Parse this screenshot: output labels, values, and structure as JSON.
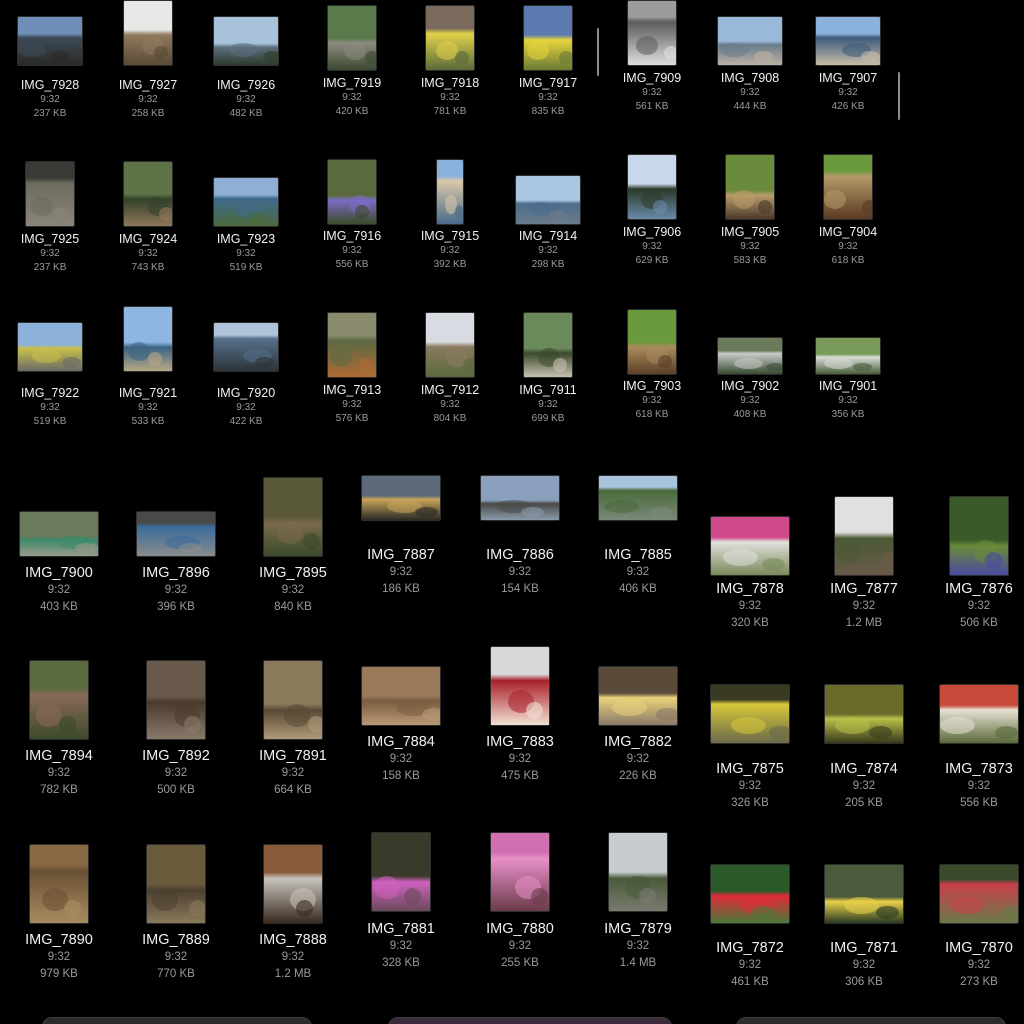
{
  "panes": [
    {
      "id": "pane-a",
      "columns": [
        "IMG_7928|237 KB",
        "IMG_7927|258 KB",
        "IMG_7926|482 KB"
      ],
      "rows": [
        [
          {
            "name": "IMG_7928",
            "time": "9:32",
            "size": "237 KB",
            "palette": [
              "#6f8fb8",
              "#3c4a58",
              "#2a2a26"
            ]
          },
          {
            "name": "IMG_7927",
            "time": "9:32",
            "size": "258 KB",
            "palette": [
              "#e8e8e6",
              "#8f7a5e",
              "#5a4a36"
            ]
          },
          {
            "name": "IMG_7926",
            "time": "9:32",
            "size": "482 KB",
            "palette": [
              "#a9c2dc",
              "#5b6f7d",
              "#2e3a2c"
            ]
          }
        ],
        [
          {
            "name": "IMG_7925",
            "time": "9:32",
            "size": "237 KB",
            "palette": [
              "#3a3a36",
              "#6d6a5f",
              "#8a8578"
            ]
          },
          {
            "name": "IMG_7924",
            "time": "9:32",
            "size": "743 KB",
            "palette": [
              "#5e7448",
              "#33422a",
              "#8f7658"
            ]
          },
          {
            "name": "IMG_7923",
            "time": "9:32",
            "size": "519 KB",
            "palette": [
              "#8fb0d4",
              "#3f6a8c",
              "#4c6a3c"
            ]
          }
        ],
        [
          {
            "name": "IMG_7922",
            "time": "9:32",
            "size": "519 KB",
            "palette": [
              "#8cb2dc",
              "#c8c04a",
              "#6a6a66"
            ]
          },
          {
            "name": "IMG_7921",
            "time": "9:32",
            "size": "533 KB",
            "palette": [
              "#8fb6e0",
              "#3c6484",
              "#b8a884"
            ]
          },
          {
            "name": "IMG_7920",
            "time": "9:32",
            "size": "422 KB",
            "palette": [
              "#aec4da",
              "#55708a",
              "#2e3438"
            ]
          }
        ]
      ]
    },
    {
      "id": "pane-b",
      "rows": [
        [
          {
            "name": "IMG_7919",
            "time": "9:32",
            "size": "420 KB",
            "palette": [
              "#5a7a4c",
              "#8a8a7c",
              "#3c4a32"
            ]
          },
          {
            "name": "IMG_7918",
            "time": "9:32",
            "size": "781 KB",
            "palette": [
              "#7a6a5c",
              "#e0d24a",
              "#5a6a3a"
            ]
          },
          {
            "name": "IMG_7917",
            "time": "9:32",
            "size": "835 KB",
            "palette": [
              "#5a7ab0",
              "#e6d43c",
              "#6a7a34"
            ]
          }
        ],
        [
          {
            "name": "IMG_7916",
            "time": "9:32",
            "size": "556 KB",
            "palette": [
              "#5a6a3c",
              "#7a6cc4",
              "#3c4a2a"
            ]
          },
          {
            "name": "IMG_7915",
            "time": "9:32",
            "size": "392 KB",
            "palette": [
              "#8ab0dc",
              "#d8c8a8",
              "#4a6a8a"
            ]
          },
          {
            "name": "IMG_7914",
            "time": "9:32",
            "size": "298 KB",
            "palette": [
              "#aac6e2",
              "#4c6c8c",
              "#6c7c8c"
            ]
          }
        ],
        [
          {
            "name": "IMG_7913",
            "time": "9:32",
            "size": "576 KB",
            "palette": [
              "#8a8a6c",
              "#5c6a44",
              "#b06a34"
            ]
          },
          {
            "name": "IMG_7912",
            "time": "9:32",
            "size": "804 KB",
            "palette": [
              "#d8dce2",
              "#8a7a60",
              "#5a6a3c"
            ]
          },
          {
            "name": "IMG_7911",
            "time": "9:32",
            "size": "699 KB",
            "palette": [
              "#6a8a5c",
              "#3a4a2c",
              "#c8c0b0"
            ]
          }
        ]
      ]
    },
    {
      "id": "pane-c",
      "rows": [
        [
          {
            "name": "IMG_7909",
            "time": "9:32",
            "size": "561 KB",
            "palette": [
              "#9a9c9e",
              "#5a5c5a",
              "#dedfe0"
            ]
          },
          {
            "name": "IMG_7908",
            "time": "9:32",
            "size": "444 KB",
            "palette": [
              "#9ab8da",
              "#6a7c8a",
              "#bcb0a4"
            ]
          },
          {
            "name": "IMG_7907",
            "time": "9:32",
            "size": "426 KB",
            "palette": [
              "#8ab0dc",
              "#3c5a7a",
              "#c8bca8"
            ]
          }
        ],
        [
          {
            "name": "IMG_7906",
            "time": "9:32",
            "size": "629 KB",
            "palette": [
              "#c8d8ea",
              "#2c3a2a",
              "#6a8aa8"
            ]
          },
          {
            "name": "IMG_7905",
            "time": "9:32",
            "size": "583 KB",
            "palette": [
              "#6a8a3c",
              "#b89c6a",
              "#4a3a2a"
            ]
          },
          {
            "name": "IMG_7904",
            "time": "9:32",
            "size": "618 KB",
            "palette": [
              "#6a9a3c",
              "#b49a6a",
              "#5a3a22"
            ]
          }
        ],
        [
          {
            "name": "IMG_7903",
            "time": "9:32",
            "size": "618 KB",
            "palette": [
              "#6a9a3c",
              "#a88a5c",
              "#5c4028"
            ]
          },
          {
            "name": "IMG_7902",
            "time": "9:32",
            "size": "408 KB",
            "palette": [
              "#6a7a5a",
              "#c8ccc8",
              "#3a4a32"
            ]
          },
          {
            "name": "IMG_7901",
            "time": "9:32",
            "size": "356 KB",
            "palette": [
              "#7a9a5a",
              "#d8dcd8",
              "#4a5c3a"
            ]
          }
        ]
      ]
    },
    {
      "id": "pane-d",
      "rows": [
        [
          {
            "name": "IMG_7900",
            "time": "9:32",
            "size": "403 KB",
            "palette": [
              "#6a7a5a",
              "#3c8a6a",
              "#9a9a8a"
            ]
          },
          {
            "name": "IMG_7896",
            "time": "9:32",
            "size": "396 KB",
            "palette": [
              "#4a4a48",
              "#3a6a9a",
              "#8a8c8c"
            ]
          },
          {
            "name": "IMG_7895",
            "time": "9:32",
            "size": "840 KB",
            "palette": [
              "#5a5a3a",
              "#7a6a4c",
              "#3a4a2a"
            ]
          }
        ],
        [
          {
            "name": "IMG_7894",
            "time": "9:32",
            "size": "782 KB",
            "palette": [
              "#5a6a3c",
              "#8a6a5a",
              "#3c4a2a"
            ]
          },
          {
            "name": "IMG_7892",
            "time": "9:32",
            "size": "500 KB",
            "palette": [
              "#6a5a4c",
              "#4a3a2c",
              "#8a7a6a"
            ]
          },
          {
            "name": "IMG_7891",
            "time": "9:32",
            "size": "664 KB",
            "palette": [
              "#8a7a5c",
              "#5a4a34",
              "#b09a7a"
            ]
          }
        ],
        [
          {
            "name": "IMG_7890",
            "time": "9:32",
            "size": "979 KB",
            "palette": [
              "#8a6a44",
              "#6a5034",
              "#a88c60"
            ]
          },
          {
            "name": "IMG_7889",
            "time": "9:32",
            "size": "770 KB",
            "palette": [
              "#6a5a3c",
              "#4c4030",
              "#8a7a5a"
            ]
          },
          {
            "name": "IMG_7888",
            "time": "9:32",
            "size": "1.2 MB",
            "palette": [
              "#8a5a3c",
              "#c8c4bc",
              "#3a2a20"
            ]
          }
        ]
      ]
    },
    {
      "id": "pane-e",
      "rows": [
        [
          {
            "name": "IMG_7887",
            "time": "9:32",
            "size": "186 KB",
            "palette": [
              "#5c6a7a",
              "#c8a45a",
              "#2a2a26"
            ]
          },
          {
            "name": "IMG_7886",
            "time": "9:32",
            "size": "154 KB",
            "palette": [
              "#8aa0bc",
              "#4a4a48",
              "#8a9aaa"
            ]
          },
          {
            "name": "IMG_7885",
            "time": "9:32",
            "size": "406 KB",
            "palette": [
              "#a8c4dc",
              "#4a6a3a",
              "#7a8a7a"
            ]
          }
        ],
        [
          {
            "name": "IMG_7884",
            "time": "9:32",
            "size": "158 KB",
            "palette": [
              "#9a7a5a",
              "#7a5c40",
              "#b89a76"
            ]
          },
          {
            "name": "IMG_7883",
            "time": "9:32",
            "size": "475 KB",
            "palette": [
              "#d8d8d8",
              "#a8202a",
              "#f2e0d4"
            ]
          },
          {
            "name": "IMG_7882",
            "time": "9:32",
            "size": "226 KB",
            "palette": [
              "#5a4a3a",
              "#e8d27a",
              "#8a7a6a"
            ]
          }
        ],
        [
          {
            "name": "IMG_7881",
            "time": "9:32",
            "size": "328 KB",
            "palette": [
              "#3a3a2a",
              "#d060c0",
              "#6a4a5a"
            ]
          },
          {
            "name": "IMG_7880",
            "time": "9:32",
            "size": "255 KB",
            "palette": [
              "#d070b0",
              "#e890c8",
              "#6a3a4a"
            ]
          },
          {
            "name": "IMG_7879",
            "time": "9:32",
            "size": "1.4 MB",
            "palette": [
              "#c8ccd0",
              "#4a5a3a",
              "#7a7a70"
            ]
          }
        ]
      ]
    },
    {
      "id": "pane-f",
      "rows": [
        [
          {
            "name": "IMG_7878",
            "time": "9:32",
            "size": "320 KB",
            "palette": [
              "#d04a8a",
              "#e0e0dc",
              "#7a8a5a"
            ]
          },
          {
            "name": "IMG_7877",
            "time": "9:32",
            "size": "1.2 MB",
            "palette": [
              "#e0e0e0",
              "#4a5a34",
              "#6a5a4a"
            ]
          },
          {
            "name": "IMG_7876",
            "time": "9:32",
            "size": "506 KB",
            "palette": [
              "#3a5a2a",
              "#6a8a3a",
              "#4a4aa0"
            ]
          }
        ],
        [
          {
            "name": "IMG_7875",
            "time": "9:32",
            "size": "326 KB",
            "palette": [
              "#3a3a24",
              "#d8c83a",
              "#6a6a4a"
            ]
          },
          {
            "name": "IMG_7874",
            "time": "9:32",
            "size": "205 KB",
            "palette": [
              "#6a6a2a",
              "#b8c04a",
              "#3a3a1c"
            ]
          },
          {
            "name": "IMG_7873",
            "time": "9:32",
            "size": "556 KB",
            "palette": [
              "#c84a3a",
              "#e8e0d4",
              "#5a6a3a"
            ]
          }
        ],
        [
          {
            "name": "IMG_7872",
            "time": "9:32",
            "size": "461 KB",
            "palette": [
              "#2a5a2a",
              "#e02a3a",
              "#4a7a3a"
            ]
          },
          {
            "name": "IMG_7871",
            "time": "9:32",
            "size": "306 KB",
            "palette": [
              "#4a5a3a",
              "#e8d04a",
              "#2a3a22"
            ]
          },
          {
            "name": "IMG_7870",
            "time": "9:32",
            "size": "273 KB",
            "palette": [
              "#3a4a2a",
              "#c8404a",
              "#6a7a4a"
            ]
          }
        ]
      ]
    }
  ]
}
